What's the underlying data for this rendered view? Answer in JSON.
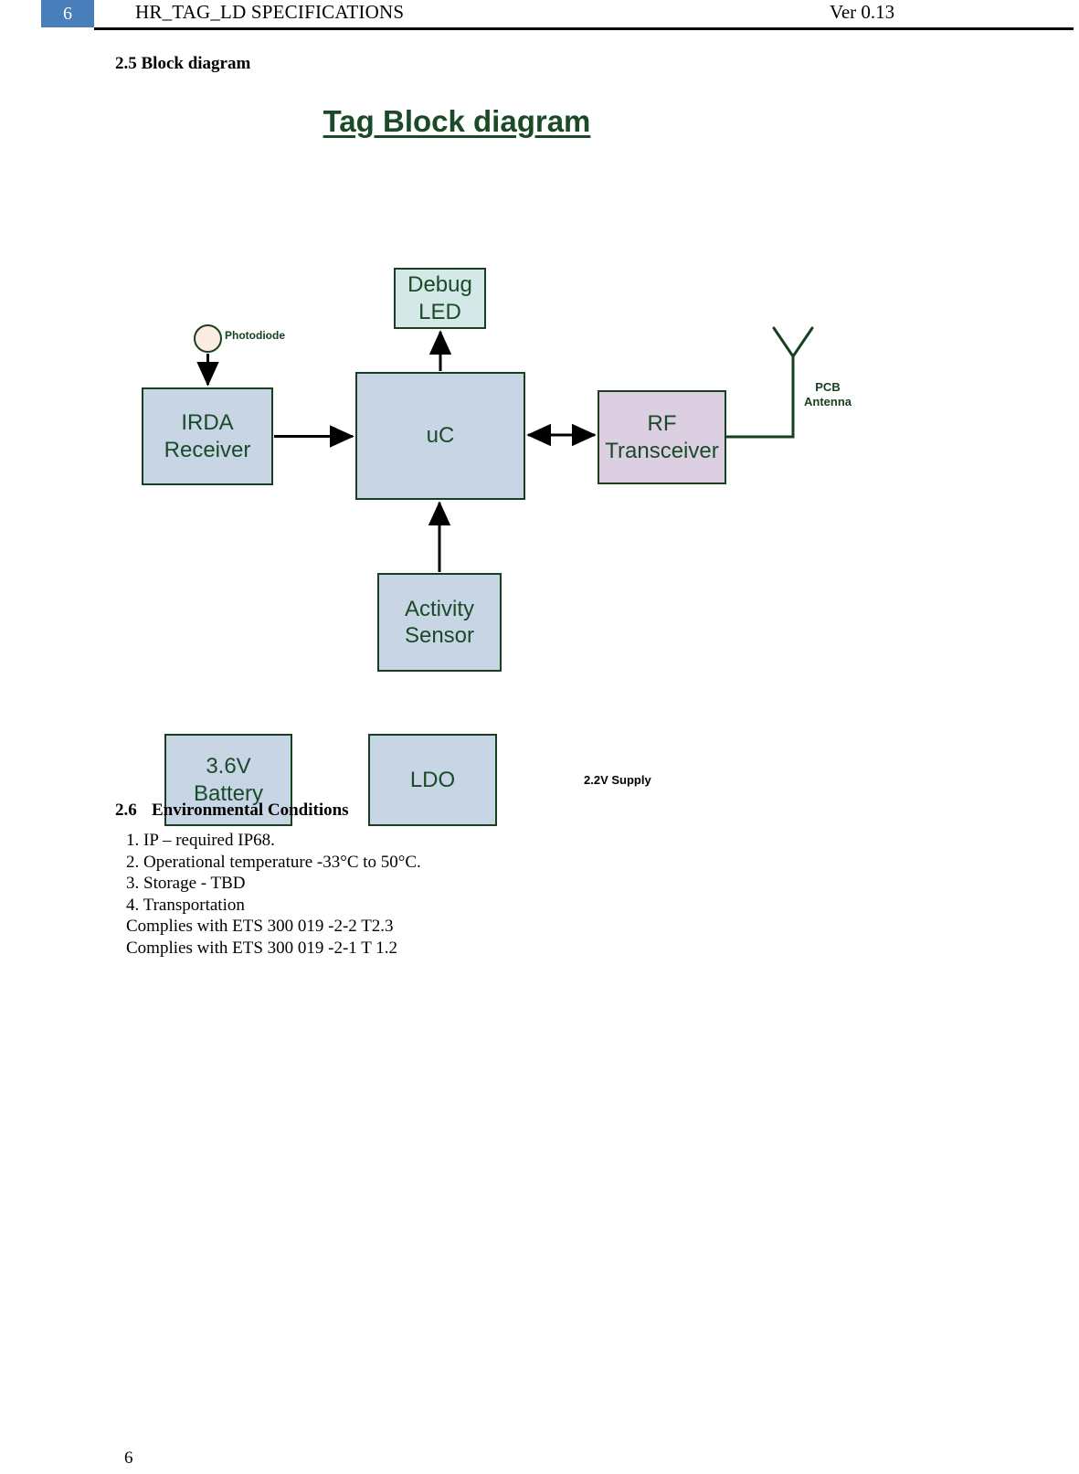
{
  "header": {
    "page_number": "6",
    "title": "HR_TAG_LD SPECIFICATIONS",
    "version": "Ver 0.13",
    "accent_color": "#4a7ebb"
  },
  "sections": {
    "block_diagram_heading": "2.5 Block diagram",
    "environmental_number": "2.6",
    "environmental_heading": "Environmental Conditions"
  },
  "diagram": {
    "title": "Tag Block diagram",
    "title_color": "#1b4a28",
    "border_color": "#16401f",
    "blocks": {
      "debug_led": "Debug\nLED",
      "irda_receiver": "IRDA\nReceiver",
      "uc": "uC",
      "rf_transceiver": "RF\nTransceiver",
      "activity_sensor": "Activity\nSensor",
      "battery": "3.6V\nBattery",
      "ldo": "LDO"
    },
    "block_colors": {
      "debug_led": "#d4e9e7",
      "irda_receiver": "#c7d5e5",
      "uc": "#c7d5e5",
      "rf_transceiver": "#ddcfe2",
      "activity_sensor": "#c7d5e5",
      "battery": "#c7d5e5",
      "ldo": "#c7d5e5",
      "photodiode": "#fbece2"
    },
    "labels": {
      "photodiode": "Photodiode",
      "pcb_antenna": "PCB\nAntenna",
      "supply": "2.2V Supply"
    }
  },
  "environmental_conditions": [
    "1. IP – required IP68.",
    "2. Operational temperature -33°C to 50°C.",
    "3. Storage - TBD",
    "4. Transportation",
    "Complies with ETS 300 019 -2-2 T2.3",
    "Complies with ETS 300 019 -2-1 T 1.2"
  ],
  "footer": {
    "page_number": "6"
  }
}
